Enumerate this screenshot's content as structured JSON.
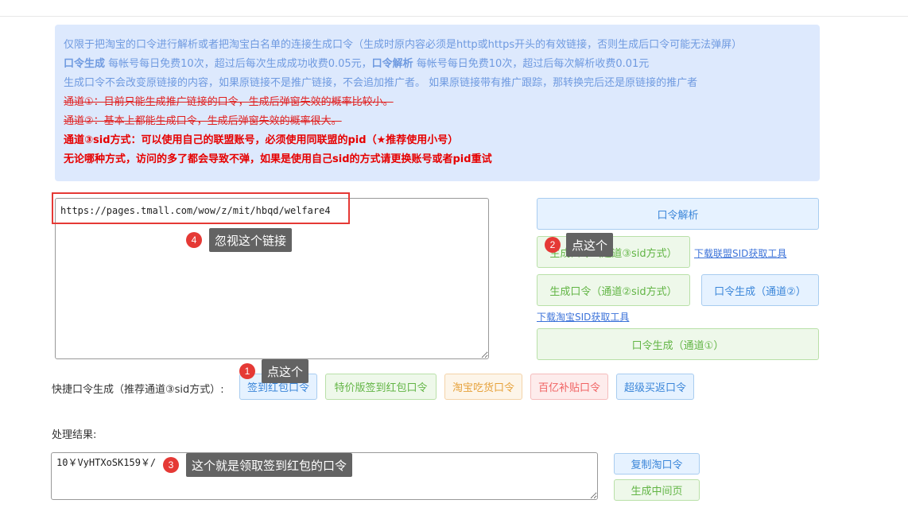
{
  "notice": {
    "line1": "仅限于把淘宝的口令进行解析或者把淘宝白名单的连接生成口令（生成时原内容必须是http或https开头的有效链接，否则生成后口令可能无法弹屏）",
    "line2_bold1": "口令生成",
    "line2_text1": " 每帐号每日免费10次，超过后每次生成成功收费0.05元，",
    "line2_bold2": "口令解析",
    "line2_text2": " 每帐号每日免费10次，超过后每次解析收费0.01元",
    "line3": "生成口令不会改变原链接的内容，如果原链接不是推广链接，不会追加推广者。 如果原链接带有推广跟踪，那转换完后还是原链接的推广者",
    "line4": "通道①：目前只能生成推广链接的口令，生成后弹窗失效的概率比较小。",
    "line5": "通道②：基本上都能生成口令，生成后弹窗失效的概率很大。",
    "line6": "通道③sid方式：可以使用自己的联盟账号，必须使用同联盟的pid（★推荐使用小号）",
    "line7": "无论哪种方式，访问的多了都会导致不弹，如果是使用自己sid的方式请更换账号或者pid重试"
  },
  "input": {
    "link_value": "https://pages.tmall.com/wow/z/mit/hbqd/welfare4"
  },
  "actions": {
    "parse": "口令解析",
    "gen_ch3": "生成口令（通道③sid方式）",
    "download_alliance_sid": "下载联盟SID获取工具",
    "gen_ch2_sid": "生成口令（通道②sid方式）",
    "gen_ch2": "口令生成（通道②）",
    "download_taobao_sid": "下载淘宝SID获取工具",
    "gen_ch1": "口令生成（通道①）"
  },
  "quick": {
    "label": "快捷口令生成（推荐通道③sid方式）:",
    "buttons": [
      "签到红包口令",
      "特价版签到红包口令",
      "淘宝吃货口令",
      "百亿补贴口令",
      "超级买返口令"
    ]
  },
  "result": {
    "label": "处理结果:",
    "value": "10￥VyHTXoSK159￥/",
    "copy": "复制淘口令",
    "gen_middle": "生成中间页"
  },
  "annotations": {
    "a1": {
      "num": "1",
      "text": "点这个"
    },
    "a2": {
      "num": "2",
      "text": "点这个"
    },
    "a3": {
      "num": "3",
      "text": "这个就是领取签到红包的口令"
    },
    "a4": {
      "num": "4",
      "text": "忽视这个链接"
    }
  },
  "colors": {
    "notice_bg": "#dde9fd",
    "notice_text": "#6f9ae0",
    "warning_red": "#e60000",
    "annotation_red": "#e53935",
    "tooltip_bg": "#636363"
  }
}
